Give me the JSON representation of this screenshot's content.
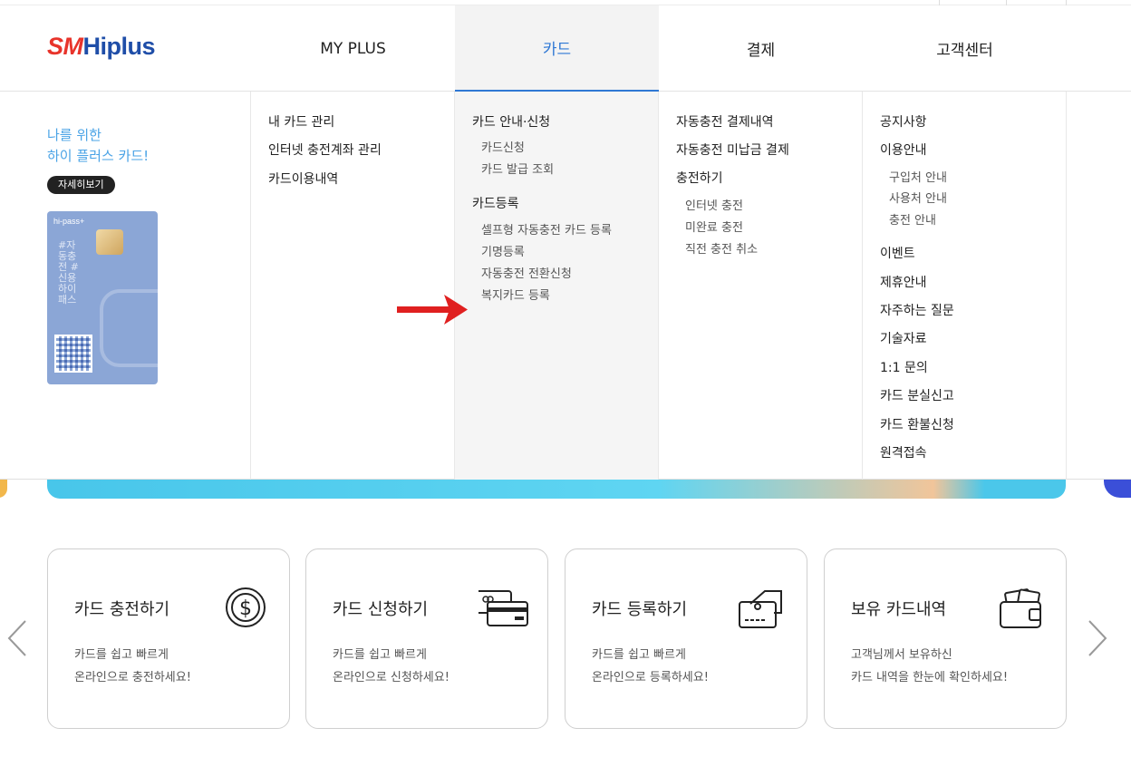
{
  "logo": {
    "sm": "SM",
    "hi": "Hiplus"
  },
  "gnb": [
    "MY PLUS",
    "카드",
    "결제",
    "고객센터"
  ],
  "promo": {
    "title_line1": "나를 위한",
    "title_line2": "하이 플러스 카드!",
    "button": "자세히보기",
    "card_brand": "hi-pass+",
    "card_text": "#자동충전 #신용하이패스"
  },
  "menu": {
    "myplus": [
      "내 카드 관리",
      "인터넷 충전계좌 관리",
      "카드이용내역"
    ],
    "card": {
      "group1": "카드 안내·신청",
      "group1_items": [
        "카드신청",
        "카드 발급 조회"
      ],
      "group2": "카드등록",
      "group2_items": [
        "셀프형 자동충전 카드 등록",
        "기명등록",
        "자동충전 전환신청",
        "복지카드 등록"
      ]
    },
    "payment": {
      "items": [
        "자동충전 결제내역",
        "자동충전 미납금 결제",
        "충전하기"
      ],
      "sub_items": [
        "인터넷 충전",
        "미완료 충전",
        "직전 충전 취소"
      ]
    },
    "support": {
      "items_top": [
        "공지사항",
        "이용안내"
      ],
      "sub_items": [
        "구입처 안내",
        "사용처 안내",
        "충전 안내"
      ],
      "items_bottom": [
        "이벤트",
        "제휴안내",
        "자주하는 질문",
        "기술자료",
        "1:1 문의",
        "카드 분실신고",
        "카드 환불신청",
        "원격접속"
      ]
    }
  },
  "quick": [
    {
      "title": "카드 충전하기",
      "desc1": "카드를 쉽고 빠르게",
      "desc2": "온라인으로 충전하세요!",
      "icon": "dollar-coin-icon"
    },
    {
      "title": "카드 신청하기",
      "desc1": "카드를 쉽고 빠르게",
      "desc2": "온라인으로 신청하세요!",
      "icon": "credit-cards-icon"
    },
    {
      "title": "카드 등록하기",
      "desc1": "카드를 쉽고 빠르게",
      "desc2": "온라인으로 등록하세요!",
      "icon": "card-register-icon"
    },
    {
      "title": "보유 카드내역",
      "desc1": "고객님께서 보유하신",
      "desc2": "카드 내역을 한눈에 확인하세요!",
      "icon": "wallet-icon"
    }
  ],
  "colors": {
    "accent": "#2f78d4",
    "promo_text": "#4aa3e6",
    "arrow": "#e02020",
    "logo_red": "#e8342b",
    "logo_blue": "#1f4ea8"
  }
}
